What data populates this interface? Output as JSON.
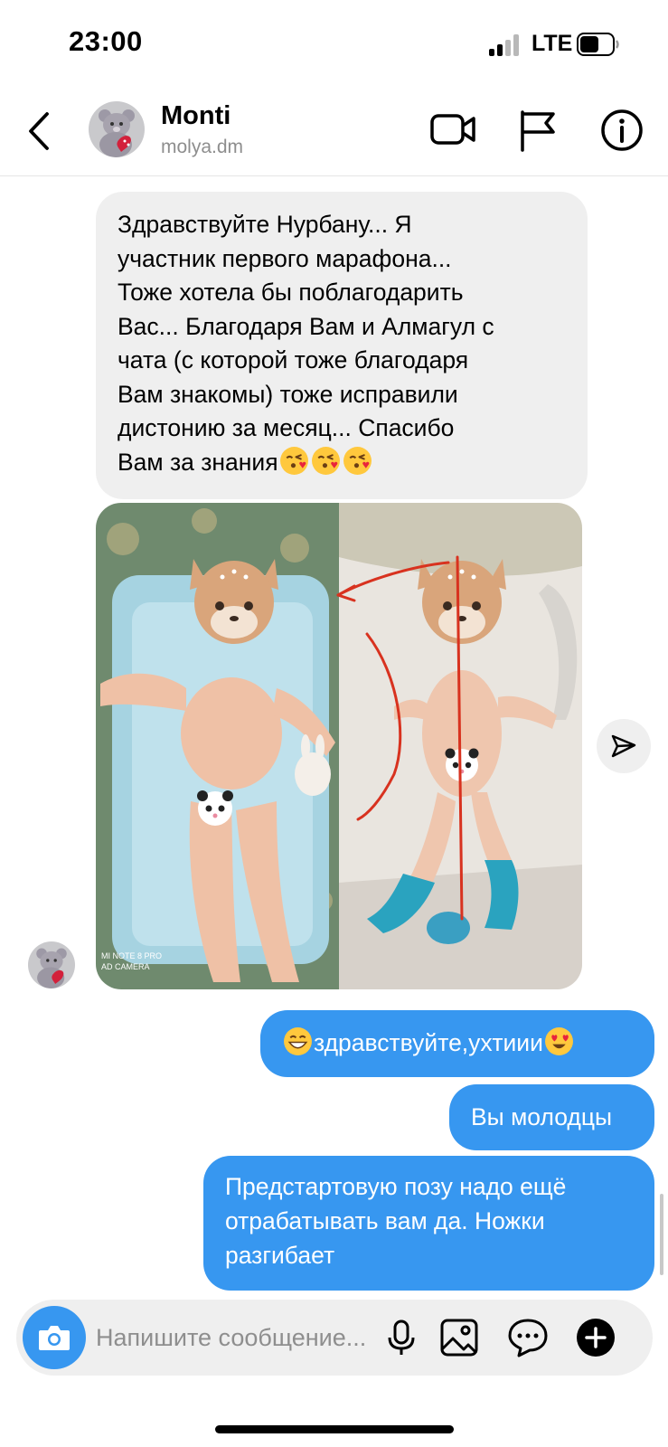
{
  "status_bar": {
    "time": "23:00",
    "network": "LTE",
    "battery_level": 0.6
  },
  "header": {
    "contact_name": "Monti",
    "contact_handle": "molya.dm",
    "icons": [
      "back-chevron-icon",
      "video-call-icon",
      "report-flag-icon",
      "info-icon"
    ]
  },
  "messages": {
    "incoming_text": {
      "lines": [
        "Здравствуйте Нурбану...  Я",
        "участник первого марафона...",
        "Тоже хотела бы поблагодарить",
        "Вас...  Благодаря Вам и Алмагул с",
        "чата (с которой тоже благодаря",
        "Вам знакомы) тоже исправили",
        "дистонию за месяц...  Спасибо",
        "Вам за знания"
      ],
      "trailing_emoji": [
        "face-blowing-kiss",
        "face-blowing-kiss",
        "face-blowing-kiss"
      ]
    },
    "incoming_photo": {
      "watermark_line1": "MI NOTE 8 PRO",
      "watermark_line2": "AD CAMERA"
    },
    "outgoing": [
      {
        "text": "здравствуйте,ухтиии",
        "leading_emoji": "grinning-face",
        "trailing_emoji": "heart-eyes-face"
      },
      {
        "text": "Вы молодцы"
      },
      {
        "lines": [
          "Предстартовую позу надо ещё",
          "отрабатывать вам да. Ножки",
          "разгибает"
        ]
      }
    ]
  },
  "composer": {
    "placeholder": "Напишите сообщение...",
    "icons": [
      "camera-icon",
      "microphone-icon",
      "gallery-icon",
      "sticker-icon",
      "plus-icon"
    ]
  },
  "colors": {
    "accent_blue": "#3797f0",
    "incoming_bubble": "#efefef",
    "secondary_text": "#8e8e8e"
  }
}
